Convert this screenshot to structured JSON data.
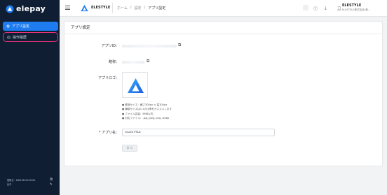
{
  "sidebar": {
    "brand": "elepay",
    "items": [
      {
        "label": "アプリ設定"
      },
      {
        "label": "操作履歴"
      }
    ],
    "footer": {
      "line1": "登録日：WD21601010021",
      "line2": "反中"
    }
  },
  "header": {
    "brand": "ELESTYLE",
    "breadcrumb": [
      "ホーム",
      "設定",
      "アプリ設定"
    ],
    "user_name": "ELESTYLE",
    "user_company": "ELESTYLE株式会社(株..."
  },
  "main": {
    "title": "アプリ設定",
    "app_id_label": "アプリID：",
    "name_label": "略称：",
    "logo_label": "アプリロゴ：",
    "notes": [
      "● 推奨サイズ：横さ300px × 高300px",
      "● 横縦サイズは1:1の比率をオススメします",
      "● ファイル容量：6MB以内",
      "● 対応ファイル：.jpg,.jpeg,.png,.webp"
    ],
    "app_name_label": "* アプリ名：",
    "app_name_value": "ELESTYLE",
    "save_label": "保 存"
  },
  "colors": {
    "sidebar_bg": "#0f1e33",
    "accent": "#1f7cf0",
    "highlight": "#e6337a"
  }
}
